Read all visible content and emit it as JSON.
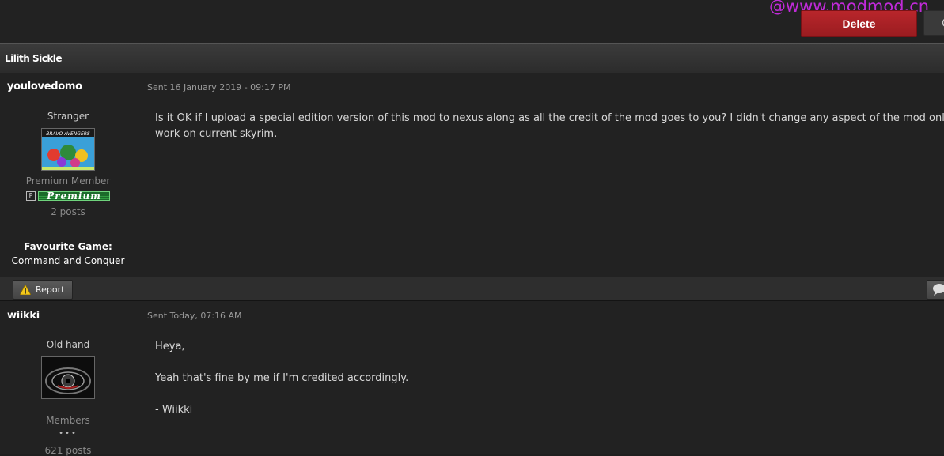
{
  "watermark": "@www.modmod.cn",
  "toolbar": {
    "delete_label": "Delete",
    "second_label": "C"
  },
  "thread": {
    "title": "Lilith Sickle"
  },
  "posts": [
    {
      "username": "youlovedomo",
      "sent": "Sent 16 January 2019 - 09:17 PM",
      "rank": "Stranger",
      "avatar_icon": "avatar-avengers-icon",
      "group": "Premium Member",
      "badge": "Premium",
      "post_count": "2 posts",
      "favourite_label": "Favourite Game:",
      "favourite_value": "Command and Conquer",
      "body": [
        "Is it OK if I upload a special edition version of this mod to nexus along as all the credit of the mod goes to you? I didn't change any aspect of the mod only jus",
        "work on current skyrim."
      ],
      "report_label": "Report"
    },
    {
      "username": "wiikki",
      "sent": "Sent Today, 07:16 AM",
      "rank": "Old hand",
      "avatar_icon": "avatar-eye-icon",
      "group": "Members",
      "dots": "•••",
      "post_count": "621 posts",
      "body": [
        "Heya,",
        "Yeah that's fine by me if I'm credited accordingly.",
        "- Wiikki"
      ]
    }
  ],
  "colors": {
    "delete": "#b8262b",
    "watermark": "#c02ad8",
    "background": "#1f1f1f"
  }
}
